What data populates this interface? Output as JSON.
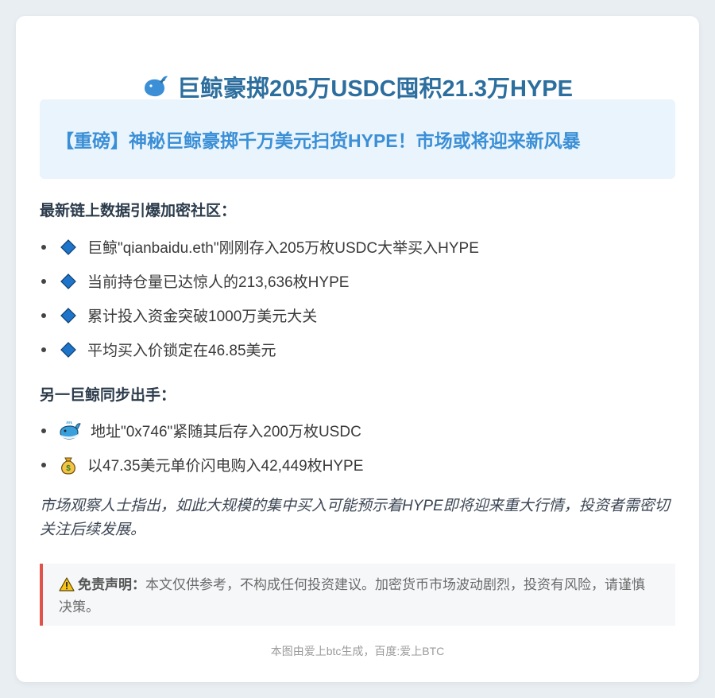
{
  "title": "巨鲸豪掷205万USDC囤积21.3万HYPE",
  "banner": "【重磅】神秘巨鲸豪掷千万美元扫货HYPE！市场或将迎来新风暴",
  "section1": {
    "heading": "最新链上数据引爆加密社区：",
    "items": [
      {
        "icon": "blue-diamond-icon",
        "text": "巨鲸\"qianbaidu.eth\"刚刚存入205万枚USDC大举买入HYPE"
      },
      {
        "icon": "blue-diamond-icon",
        "text": "当前持仓量已达惊人的213,636枚HYPE"
      },
      {
        "icon": "blue-diamond-icon",
        "text": "累计投入资金突破1000万美元大关"
      },
      {
        "icon": "blue-diamond-icon",
        "text": "平均买入价锁定在46.85美元"
      }
    ]
  },
  "section2": {
    "heading": "另一巨鲸同步出手：",
    "items": [
      {
        "icon": "whale-icon",
        "text": "地址\"0x746\"紧随其后存入200万枚USDC"
      },
      {
        "icon": "money-bag-icon",
        "text": "以47.35美元单价闪电购入42,449枚HYPE"
      }
    ]
  },
  "note": "市场观察人士指出，如此大规模的集中买入可能预示着HYPE即将迎来重大行情，投资者需密切关注后续发展。",
  "disclaimer": {
    "icon": "warning-icon",
    "label": "免责声明：",
    "text": "本文仅供参考，不构成任何投资建议。加密货币市场波动剧烈，投资有风险，请谨慎决策。"
  },
  "footer": "本图由爱上btc生成，百度:爱上BTC",
  "colors": {
    "title": "#2c6e9e",
    "banner_text": "#3a8fd6",
    "banner_bg": "#eaf4fd",
    "disclaimer_border": "#e0534b",
    "diamond": "#1d74c9"
  }
}
